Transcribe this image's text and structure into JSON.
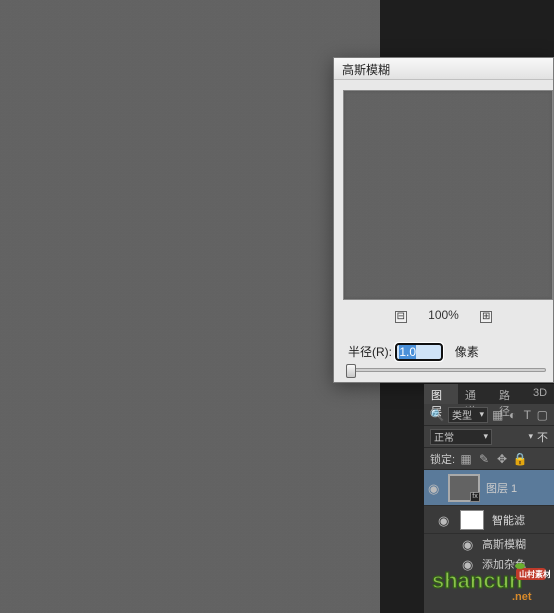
{
  "dialog": {
    "title": "高斯模糊",
    "zoom_minus": "⊟",
    "zoom_label": "100%",
    "zoom_plus": "⊞",
    "radius_label": "半径(R):",
    "radius_value": "1.0",
    "radius_unit": "像素"
  },
  "panels": {
    "tabs": {
      "layers": "图层",
      "channels": "通道",
      "paths": "路径",
      "threeD": "3D"
    },
    "kind_label": "类型",
    "blend_mode": "正常",
    "opacity_label": "不",
    "lock_label": "锁定:",
    "layer1_name": "图层 1",
    "smart_filters": "智能滤",
    "effect_gaussian": "高斯模糊",
    "effect_noise": "添加杂色"
  },
  "watermark": {
    "brand": "shancun",
    "suffix": ".net",
    "tag": "山村素材"
  },
  "icons": {
    "eye": "◉",
    "search": "🔍",
    "chev_down": "▾",
    "img": "▦",
    "adj": "◐",
    "txt": "T",
    "shape": "▢",
    "fx": "fx",
    "lock_trans": "▦",
    "brush": "✎",
    "move": "✥",
    "lock": "🔒"
  }
}
